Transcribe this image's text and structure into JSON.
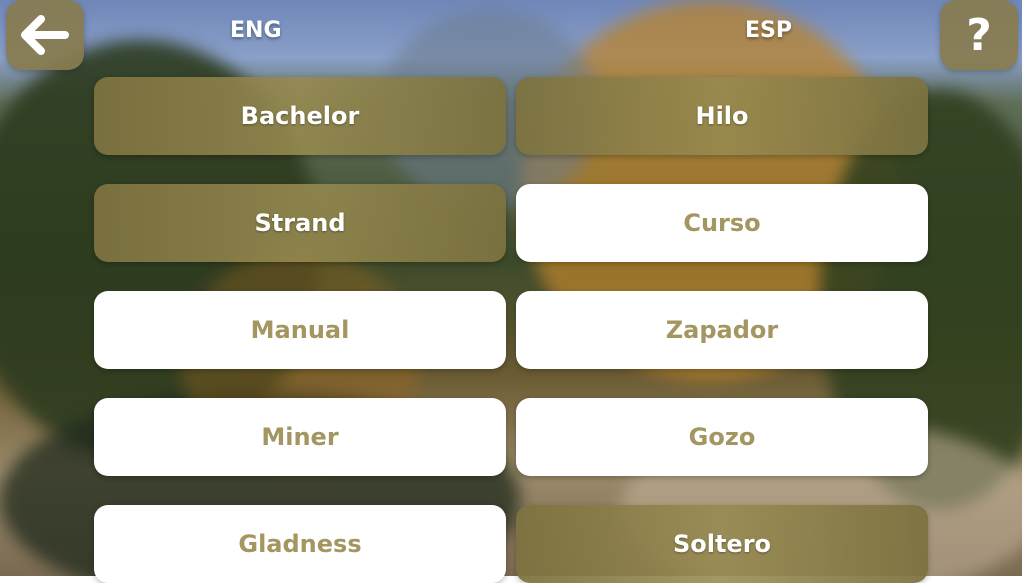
{
  "header": {
    "left_lang": "ENG",
    "right_lang": "ESP",
    "help_label": "?"
  },
  "icons": {
    "back": "arrow-left-icon",
    "help": "question-mark"
  },
  "colors": {
    "selected": "#8b7f4a",
    "normal_bg": "#ffffff",
    "normal_text": "#a39660",
    "selected_text": "#ffffff"
  },
  "left_cards": [
    {
      "label": "Bachelor",
      "state": "selected"
    },
    {
      "label": "Strand",
      "state": "selected"
    },
    {
      "label": "Manual",
      "state": "normal"
    },
    {
      "label": "Miner",
      "state": "normal"
    },
    {
      "label": "Gladness",
      "state": "normal"
    }
  ],
  "right_cards": [
    {
      "label": "Hilo",
      "state": "selected"
    },
    {
      "label": "Curso",
      "state": "normal"
    },
    {
      "label": "Zapador",
      "state": "normal"
    },
    {
      "label": "Gozo",
      "state": "normal"
    },
    {
      "label": "Soltero",
      "state": "selected"
    }
  ]
}
